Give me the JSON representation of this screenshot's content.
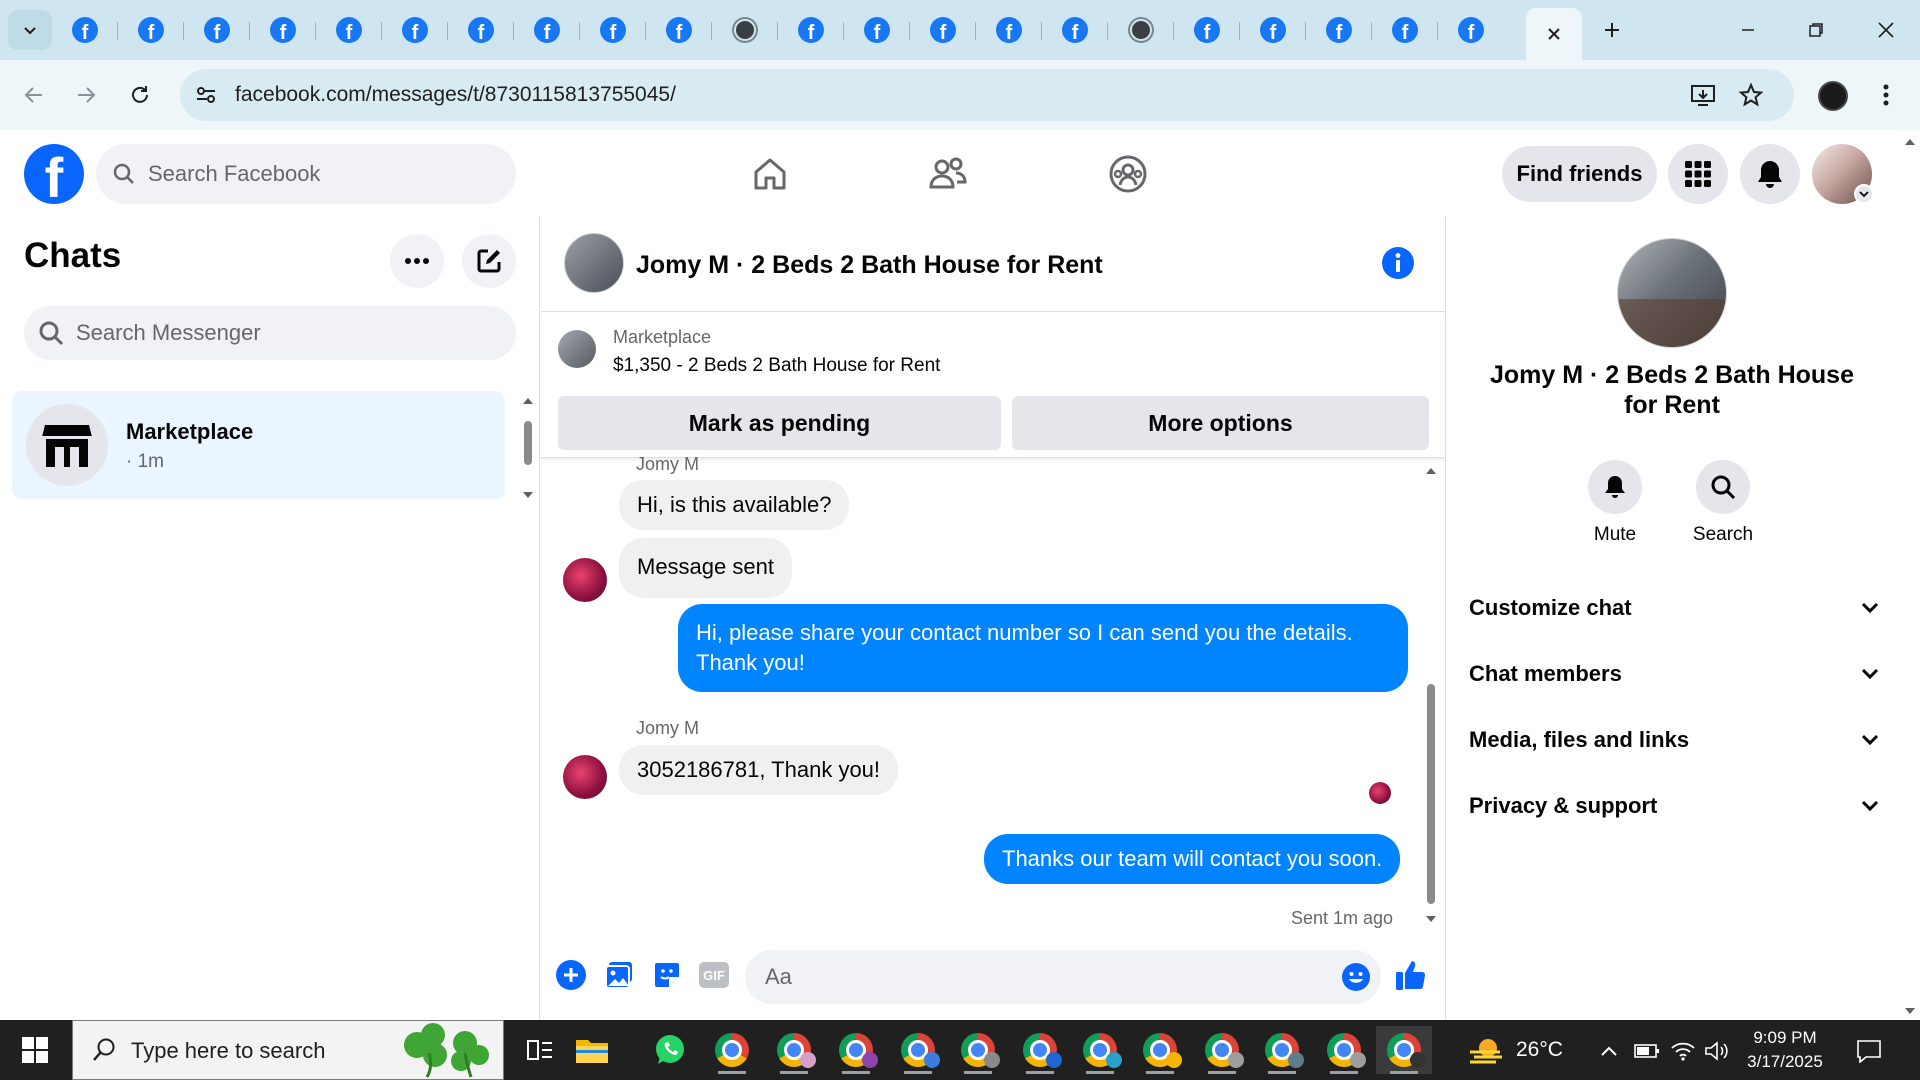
{
  "browser": {
    "url": "facebook.com/messages/t/8730115813755045/",
    "tab_count_facebook": 21
  },
  "header": {
    "search_placeholder": "Search Facebook",
    "find_friends_label": "Find friends"
  },
  "chats": {
    "title": "Chats",
    "search_placeholder": "Search Messenger",
    "items": [
      {
        "name": "Marketplace",
        "time": "· 1m"
      }
    ]
  },
  "conversation": {
    "title": "Jomy M · 2 Beds 2 Bath House for Rent",
    "listing": {
      "source": "Marketplace",
      "title": "$1,350 - 2 Beds 2 Bath House for Rent",
      "mark_pending_label": "Mark as pending",
      "more_options_label": "More options"
    },
    "messages": [
      {
        "sender": "Jomy M",
        "text": "Hi, is this available?",
        "direction": "in"
      },
      {
        "text": "Message sent",
        "direction": "in"
      },
      {
        "text": "Hi, please share your contact number so I can send you the details. Thank you!",
        "direction": "out"
      },
      {
        "sender": "Jomy M",
        "text": "3052186781, Thank you!",
        "direction": "in"
      },
      {
        "text": "Thanks our team will contact you soon.",
        "direction": "out"
      }
    ],
    "status": "Sent 1m ago",
    "composer_placeholder": "Aa",
    "gif_label": "GIF"
  },
  "details": {
    "name": "Jomy M · 2 Beds 2 Bath House for Rent",
    "actions": [
      {
        "label": "Mute",
        "icon": "bell-icon"
      },
      {
        "label": "Search",
        "icon": "search-icon"
      }
    ],
    "sections": [
      {
        "label": "Customize chat"
      },
      {
        "label": "Chat members"
      },
      {
        "label": "Media, files and links"
      },
      {
        "label": "Privacy & support"
      }
    ]
  },
  "taskbar": {
    "search_placeholder": "Type here to search",
    "temperature": "26°C",
    "time": "9:09 PM",
    "date": "3/17/2025"
  },
  "colors": {
    "facebook_blue": "#0866ff",
    "messenger_blue": "#0084ff",
    "selected_chat_bg": "#ebf5ff"
  }
}
